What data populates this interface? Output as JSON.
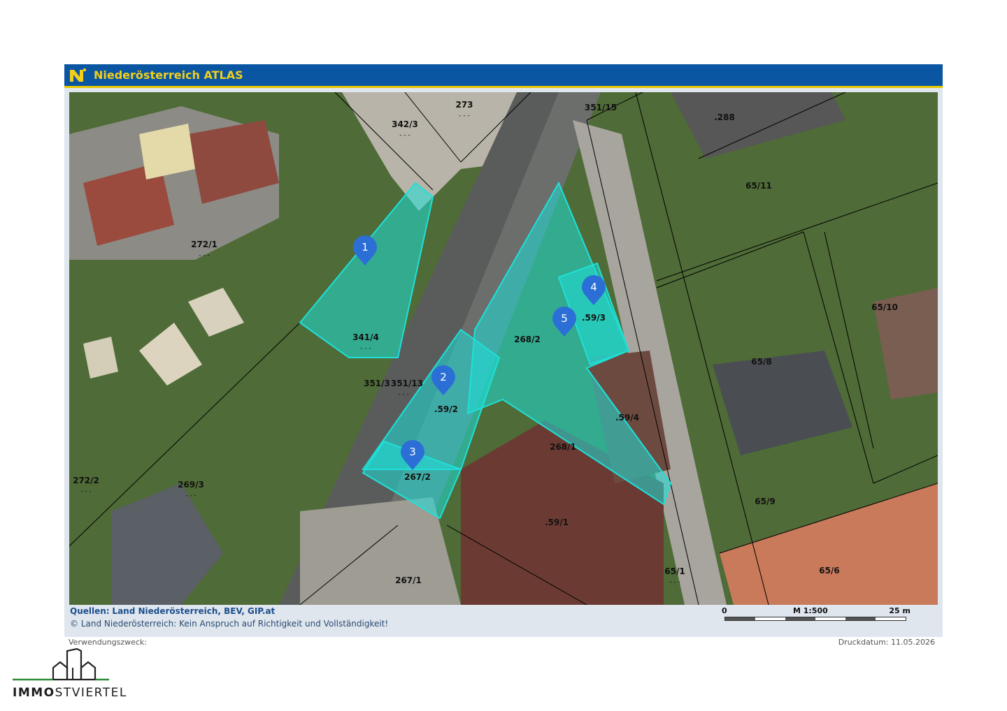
{
  "header": {
    "title": "Niederösterreich ATLAS",
    "logo_glyph": "N"
  },
  "map": {
    "parcels": [
      {
        "id": "273",
        "dots": "- - -"
      },
      {
        "id": "342/3",
        "dots": "- - -"
      },
      {
        "id": "351/15",
        "dots": ""
      },
      {
        "id": ".288",
        "dots": ""
      },
      {
        "id": "65/11",
        "dots": ""
      },
      {
        "id": "272/1",
        "dots": "- - -"
      },
      {
        "id": "341/4",
        "dots": "- - -"
      },
      {
        "id": "65/10",
        "dots": ""
      },
      {
        "id": "268/2",
        "dots": ""
      },
      {
        "id": ".59/3",
        "dots": ""
      },
      {
        "id": "65/8",
        "dots": ""
      },
      {
        "id": "351/3",
        "dots": ""
      },
      {
        "id": "351/13",
        "dots": "- - -"
      },
      {
        "id": ".59/2",
        "dots": ""
      },
      {
        "id": ".59/4",
        "dots": ""
      },
      {
        "id": "268/1",
        "dots": ""
      },
      {
        "id": "272/2",
        "dots": "- - -"
      },
      {
        "id": "269/3",
        "dots": "- - -"
      },
      {
        "id": "267/2",
        "dots": ""
      },
      {
        "id": "65/9",
        "dots": ""
      },
      {
        "id": ".59/1",
        "dots": ""
      },
      {
        "id": "65/1",
        "dots": "- - -"
      },
      {
        "id": "267/1",
        "dots": ""
      },
      {
        "id": "65/6",
        "dots": ""
      }
    ],
    "markers": [
      "1",
      "2",
      "3",
      "4",
      "5"
    ],
    "colors": {
      "highlight": "#1ee0d8",
      "marker": "#2b6fd6",
      "header_bg": "#0a56a3",
      "header_text": "#f3cf1a"
    }
  },
  "footer": {
    "source_label": "Quellen:",
    "source_text": "Land Niederösterreich, BEV, GIP.at",
    "copyright": "© Land Niederösterreich: Kein Anspruch auf Richtigkeit und Vollständigkeit!",
    "usage": "Verwendungszweck:",
    "print_date": "Druckdatum: 11.05.2026"
  },
  "scale": {
    "start": "0",
    "ratio": "M 1:500",
    "end": "25 m"
  },
  "brand": {
    "bold": "IMMO",
    "rest": "STVIERTEL"
  }
}
